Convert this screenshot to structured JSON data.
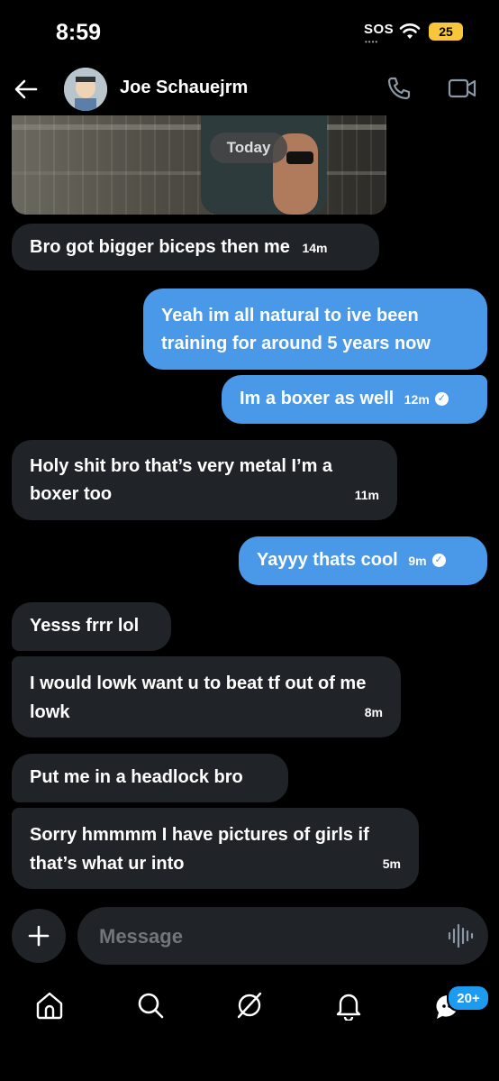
{
  "status_bar": {
    "time": "8:59",
    "sos": "SOS",
    "battery": "25"
  },
  "header": {
    "contact_name": "Joe Schauejrm"
  },
  "media": {
    "date_label": "Today"
  },
  "messages": [
    {
      "side": "received",
      "text": "Bro got bigger biceps then me",
      "time": "14m"
    },
    {
      "side": "sent",
      "text": "Yeah im all natural to ive been training for around 5 years now",
      "time": ""
    },
    {
      "side": "sent",
      "text": "Im a boxer as well",
      "time": "12m"
    },
    {
      "side": "received",
      "text": "Holy shit bro that’s very metal I’m a boxer too",
      "time": "11m"
    },
    {
      "side": "sent",
      "text": "Yayyy thats cool",
      "time": "9m"
    },
    {
      "side": "received",
      "text": "Yesss frrr lol",
      "time": ""
    },
    {
      "side": "received",
      "text": "I would lowk want u to beat tf out of me lowk",
      "time": "8m"
    },
    {
      "side": "received",
      "text": "Put me in a headlock bro",
      "time": ""
    },
    {
      "side": "received",
      "text": "Sorry hmmmm I have pictures of girls if that’s what ur into",
      "time": "5m"
    }
  ],
  "composer": {
    "placeholder": "Message"
  },
  "nav": {
    "items": [
      "home-icon",
      "search-icon",
      "grok-icon",
      "notifications-icon",
      "messages-icon"
    ],
    "badge": "20+"
  },
  "colors": {
    "sent_bubble": "#4a99e9",
    "received_bubble": "#202327",
    "background": "#000000",
    "accent": "#1d9bf0"
  }
}
